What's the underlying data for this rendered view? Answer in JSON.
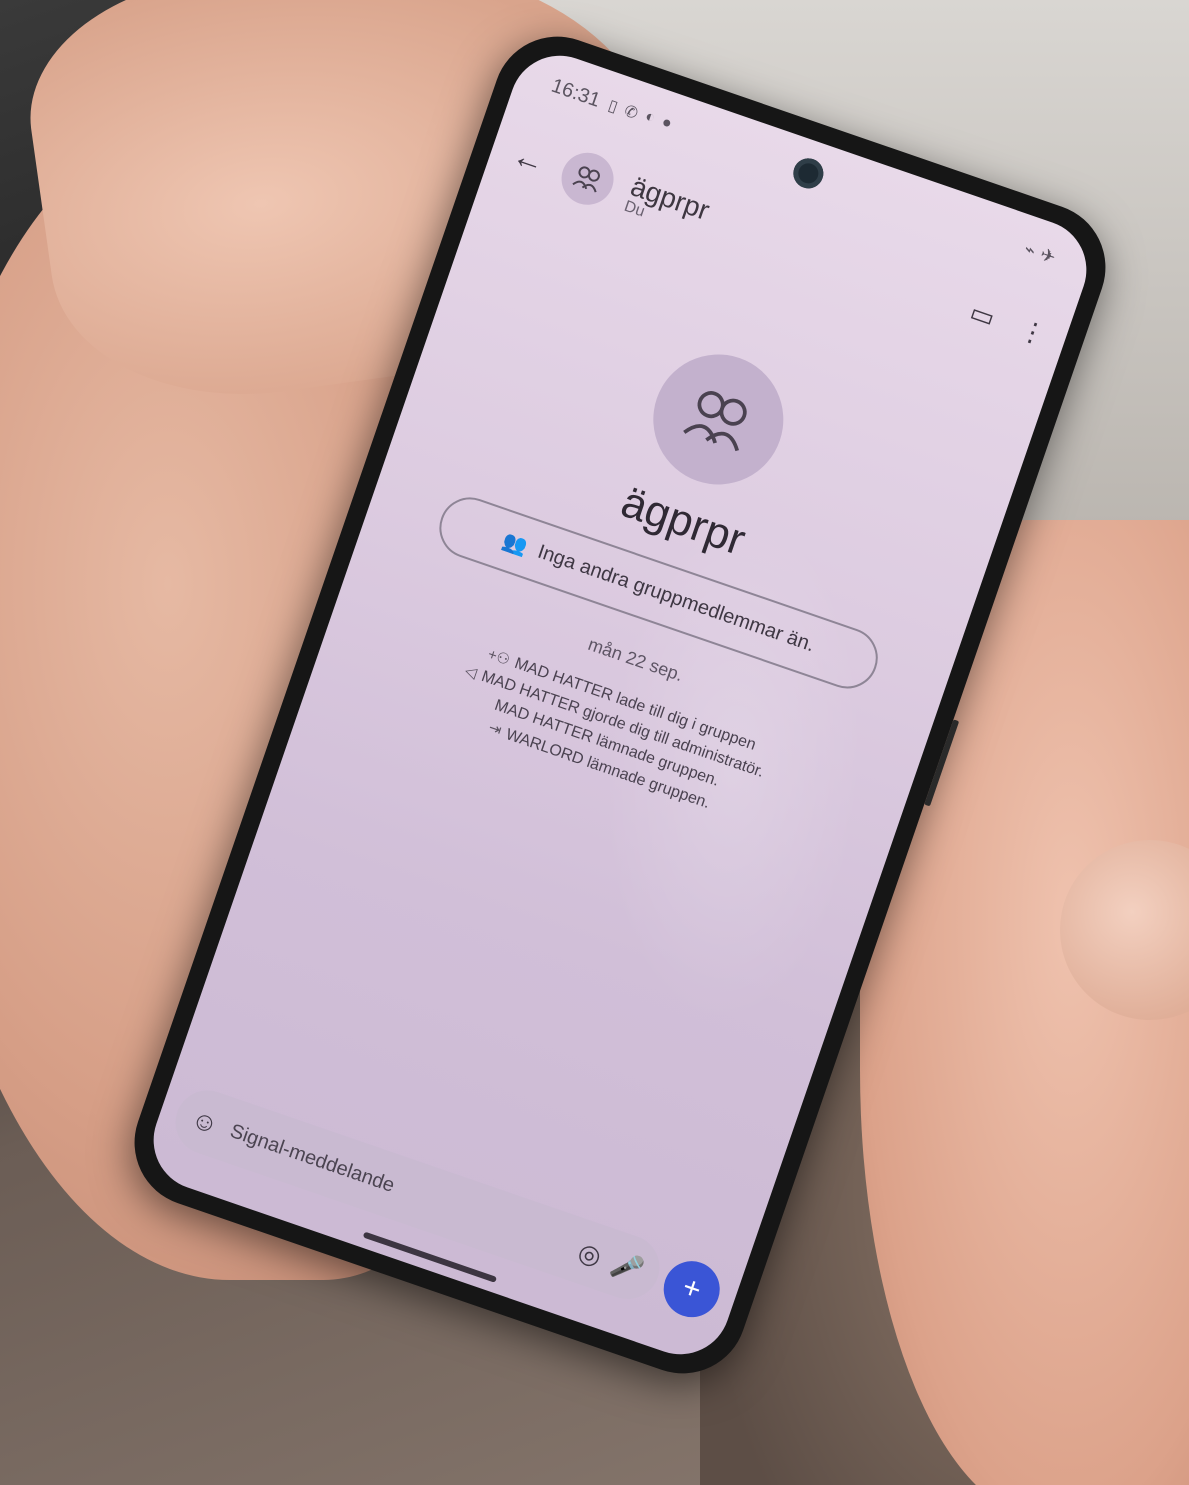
{
  "status_bar": {
    "time": "16:31",
    "icons": [
      "sim-icon",
      "notification-icon",
      "notification-icon",
      "notification-icon"
    ]
  },
  "header": {
    "back_icon": "arrow-left-icon",
    "title": "ägprpr",
    "subtitle": "Du",
    "actions": [
      "video-call-icon",
      "more-vertical-icon"
    ]
  },
  "group": {
    "name": "ägprpr",
    "members_text": "Inga andra gruppmedlemmar än."
  },
  "timeline": {
    "date": "mån 22 sep.",
    "events": [
      {
        "icon": "add-user-icon",
        "text": "MAD HATTER lade till dig i gruppen"
      },
      {
        "icon": "megaphone-icon",
        "text": "MAD HATTER gjorde dig till administratör."
      },
      {
        "icon": "",
        "text": "MAD HATTER lämnade gruppen."
      },
      {
        "icon": "leave-icon",
        "text": "WARLORD lämnade gruppen."
      }
    ]
  },
  "composer": {
    "placeholder": "Signal-meddelande",
    "icons": [
      "emoji-icon",
      "camera-icon",
      "mic-icon"
    ]
  },
  "send_button": {
    "label": "+",
    "color": "#3a55d6"
  },
  "colors": {
    "screen_bg": "#dccbe0",
    "accent": "#3a55d6"
  }
}
